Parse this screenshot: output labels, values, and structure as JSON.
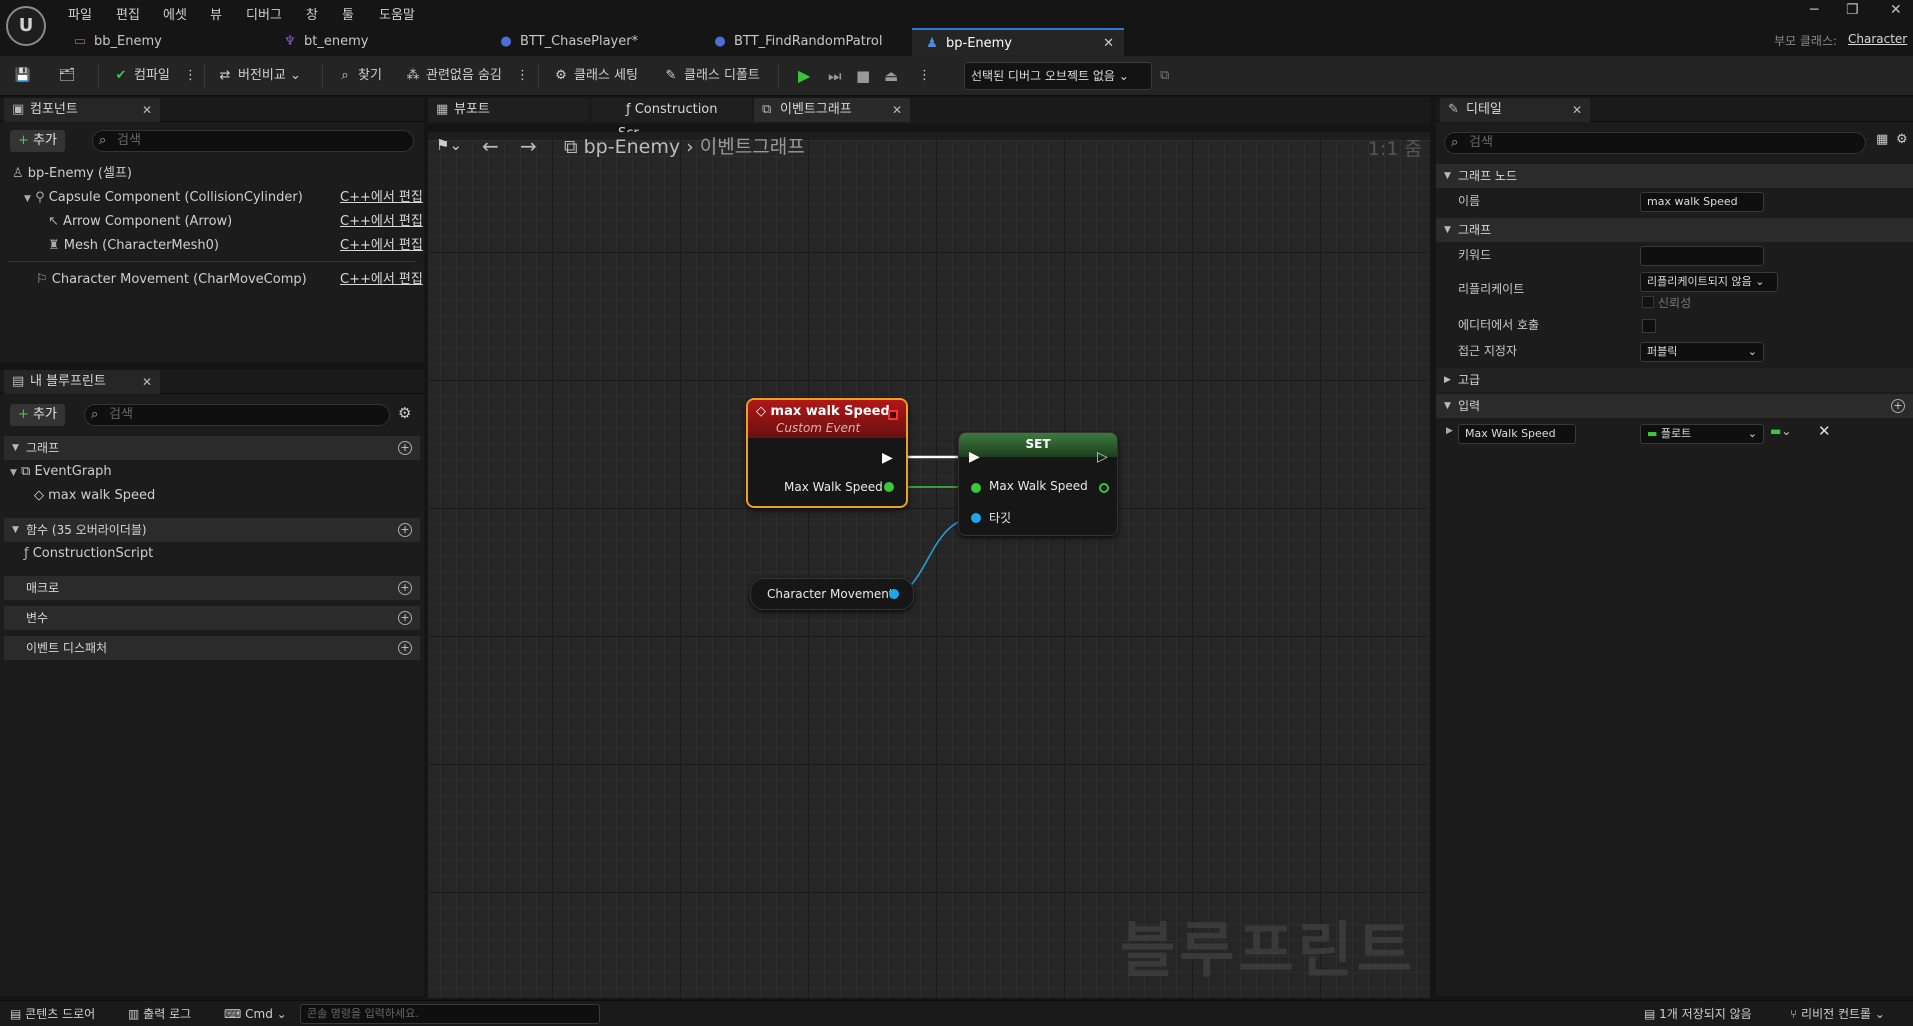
{
  "menu": [
    "파일",
    "편집",
    "에셋",
    "뷰",
    "디버그",
    "창",
    "툴",
    "도움말"
  ],
  "tabs": [
    {
      "label": "bb_Enemy",
      "icon": "blackboard-icon",
      "color": "#c04a5a"
    },
    {
      "label": "bt_enemy",
      "icon": "behavior-tree-icon",
      "color": "#8b5bd0"
    },
    {
      "label": "BTT_ChasePlayer*",
      "icon": "task-blueprint-icon",
      "color": "#4a6fd8"
    },
    {
      "label": "BTT_FindRandomPatrol",
      "icon": "task-blueprint-icon",
      "color": "#4a6fd8"
    },
    {
      "label": "bp-Enemy",
      "icon": "character-blueprint-icon",
      "color": "#4a8ad8"
    }
  ],
  "parent_class": {
    "label": "부모 클래스:",
    "value": "Character"
  },
  "toolbar": {
    "compile": "컴파일",
    "diff": "버전비교",
    "find": "찾기",
    "hide_unrelated": "관련없음 숨김",
    "class_settings": "클래스 세팅",
    "class_defaults": "클래스 디폴트",
    "debug_object": "선택된 디버그 오브젝트 없음"
  },
  "components": {
    "title": "컴포넌트",
    "add": "추가",
    "search_placeholder": "검색",
    "root": "bp-Enemy (셀프)",
    "items": [
      {
        "label": "Capsule Component (CollisionCylinder)",
        "edit": "C++에서 편집"
      },
      {
        "label": "Arrow Component (Arrow)",
        "edit": "C++에서 편집"
      },
      {
        "label": "Mesh (CharacterMesh0)",
        "edit": "C++에서 편집"
      },
      {
        "label": "Character Movement (CharMoveComp)",
        "edit": "C++에서 편집"
      }
    ]
  },
  "myblueprint": {
    "title": "내 블루프린트",
    "add": "추가",
    "search_placeholder": "검색",
    "graph_section": "그래프",
    "event_graph": "EventGraph",
    "event_item": "max walk Speed",
    "functions_section": "함수 (35 오버라이더블)",
    "construction": "ConstructionScript",
    "macros": "매크로",
    "variables": "변수",
    "dispatchers": "이벤트 디스패처"
  },
  "editor_tabs": [
    "뷰포트",
    "Construction Scr...",
    "이벤트그래프"
  ],
  "breadcrumb": {
    "root": "bp-Enemy",
    "current": "이벤트그래프",
    "zoom": "1:1 줌"
  },
  "watermark": "블루프린트",
  "nodes": {
    "event": {
      "title": "max walk Speed",
      "subtitle": "Custom Event",
      "pin": "Max Walk Speed"
    },
    "set": {
      "title": "SET",
      "pin_in": "Max Walk Speed",
      "target": "타깃"
    },
    "getter": {
      "label": "Character Movement"
    }
  },
  "details": {
    "title": "디테일",
    "search_placeholder": "검색",
    "graph_node_section": "그래프 노드",
    "name_label": "이름",
    "name_value": "max walk Speed",
    "graph_section": "그래프",
    "keywords_label": "키워드",
    "keywords_value": "",
    "replicates_label": "리플리케이트",
    "replicates_value": "리플리케이트되지 않음",
    "reliable": "신뢰성",
    "call_in_editor": "에디터에서 호출",
    "access_label": "접근 지정자",
    "access_value": "퍼블릭",
    "advanced": "고급",
    "inputs_section": "입력",
    "input_name": "Max Walk Speed",
    "input_type": "플로트"
  },
  "status": {
    "content_drawer": "콘텐츠 드로어",
    "output_log": "출력 로그",
    "cmd": "Cmd",
    "console_placeholder": "콘솔 명령을 입력하세요.",
    "unsaved": "1개 저장되지 않음",
    "revision": "리비전 컨트롤"
  },
  "colors": {
    "accent": "#2a7bd8",
    "exec_white": "#ffffff",
    "float_pin": "#38c93a",
    "object_pin": "#1ea7e8",
    "event_header": "#a01818",
    "set_header": "#2e6a2e",
    "selected_outline": "#f0a020"
  }
}
